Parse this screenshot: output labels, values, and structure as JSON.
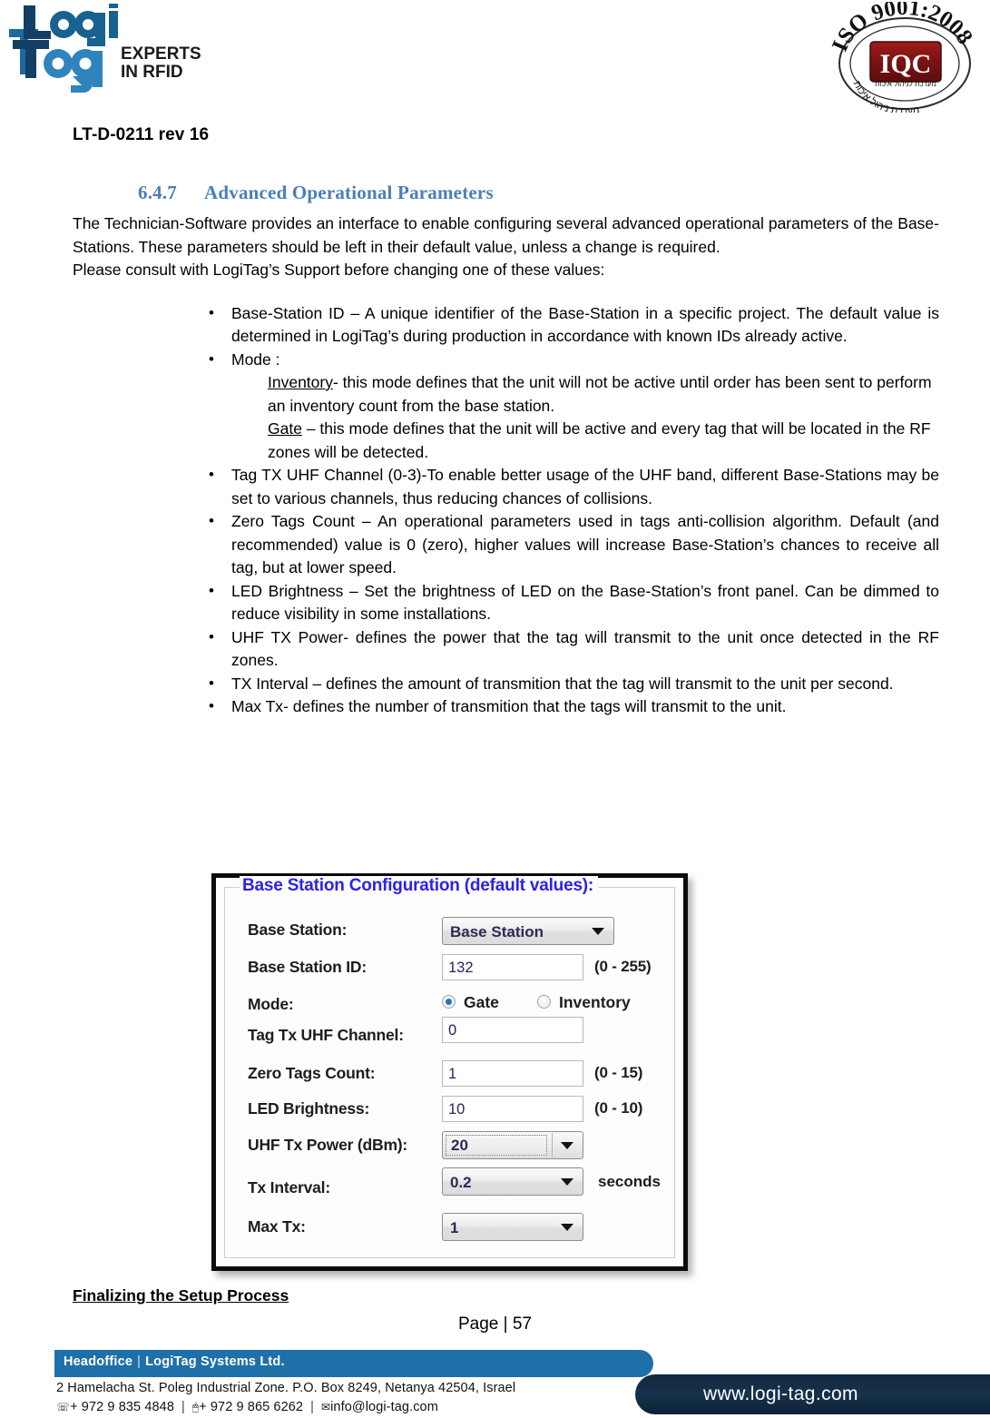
{
  "header": {
    "logo_main": "Logi",
    "logo_sub": "Tag",
    "logo_tagline_1": "EXPERTS",
    "logo_tagline_2": "IN RFID",
    "iso_arc_text": "ISO 9001:2008",
    "iso_mark": "IQC",
    "iso_hebrew_top": "מערכת לניהול איכות",
    "iso_hebrew_bottom": "מערכת ניהול איכות",
    "doc_code": "LT-D-0211 rev 16"
  },
  "section": {
    "number": "6.4.7",
    "title": "Advanced Operational Parameters",
    "intro_paragraph": "The Technician-Software provides an interface to enable configuring several advanced operational parameters of the Base-Stations. These parameters should be left in their default value, unless a change is required.",
    "consult_paragraph": "Please consult with LogiTag’s Support before changing one of these values:"
  },
  "bullets": [
    {
      "text": "Base-Station ID – A unique identifier of the Base-Station in a specific project. The default value is determined in LogiTag’s during production in accordance with known IDs already active."
    },
    {
      "text": "Mode :",
      "sub_items": [
        {
          "term": "Inventory",
          "desc": "- this mode defines that the unit will not be active until order has been sent to perform an inventory count from the base station."
        },
        {
          "term": "Gate",
          "desc": " – this mode defines that the unit will be active and every tag that will be located in the RF zones will be detected."
        }
      ]
    },
    {
      "text": "Tag TX UHF Channel (0-3)-To enable better usage of the UHF band, different Base-Stations may be set to various channels, thus reducing chances of collisions."
    },
    {
      "text": "Zero Tags Count – An operational parameters used in tags anti-collision algorithm. Default (and recommended) value is 0 (zero), higher values will increase Base-Station’s chances to receive all tag, but at lower speed."
    },
    {
      "text": "LED Brightness – Set the brightness of LED on the Base-Station’s front panel. Can be dimmed to reduce visibility in some installations."
    },
    {
      "text": "UHF TX Power- defines the power that the tag will transmit to the unit once detected in the RF zones."
    },
    {
      "text": "TX Interval – defines the amount of transmition that the tag will transmit to the unit per second."
    },
    {
      "text": "Max Tx- defines the number of transmition that the tags will transmit to the unit."
    }
  ],
  "dialog": {
    "groupbox_title": "Base Station Configuration (default values):",
    "fields": {
      "base_station_label": "Base Station:",
      "base_station_value": "Base Station",
      "base_station_id_label": "Base Station ID:",
      "base_station_id_value": "132",
      "base_station_id_hint": "(0 - 255)",
      "mode_label": "Mode:",
      "mode_gate_label": "Gate",
      "mode_inventory_label": "Inventory",
      "tag_tx_uhf_channel_label": "Tag Tx UHF Channel:",
      "tag_tx_uhf_channel_value": "0",
      "zero_tags_count_label": "Zero Tags Count:",
      "zero_tags_count_value": "1",
      "zero_tags_count_hint": "(0 - 15)",
      "led_brightness_label": "LED Brightness:",
      "led_brightness_value": "10",
      "led_brightness_hint": "(0 - 10)",
      "uhf_tx_power_label": "UHF Tx Power (dBm):",
      "uhf_tx_power_value": "20",
      "tx_interval_label": "Tx Interval:",
      "tx_interval_value": "0.2",
      "tx_interval_unit": "seconds",
      "max_tx_label": "Max Tx:",
      "max_tx_value": "1"
    },
    "accent_title_color": "#2b22e8",
    "radio_selected_color": "#1878c8"
  },
  "footer": {
    "finalizing_heading": "Finalizing the Setup Process",
    "page_label": "Page | 57",
    "bar_headoffice": "Headoffice",
    "bar_separator": "|",
    "bar_company": "LogiTag Systems Ltd.",
    "address": "2 Hamelacha St. Poleg Industrial Zone.  P.O. Box 8249, Netanya 42504, Israel",
    "phone": "+ 972 9 835 4848",
    "fax": "+ 972 9 865 6262",
    "email": "info@logi-tag.com",
    "website": "www.logi-tag.com",
    "bar_color": "#1f6fa8",
    "web_banner_color": "#12283d"
  }
}
